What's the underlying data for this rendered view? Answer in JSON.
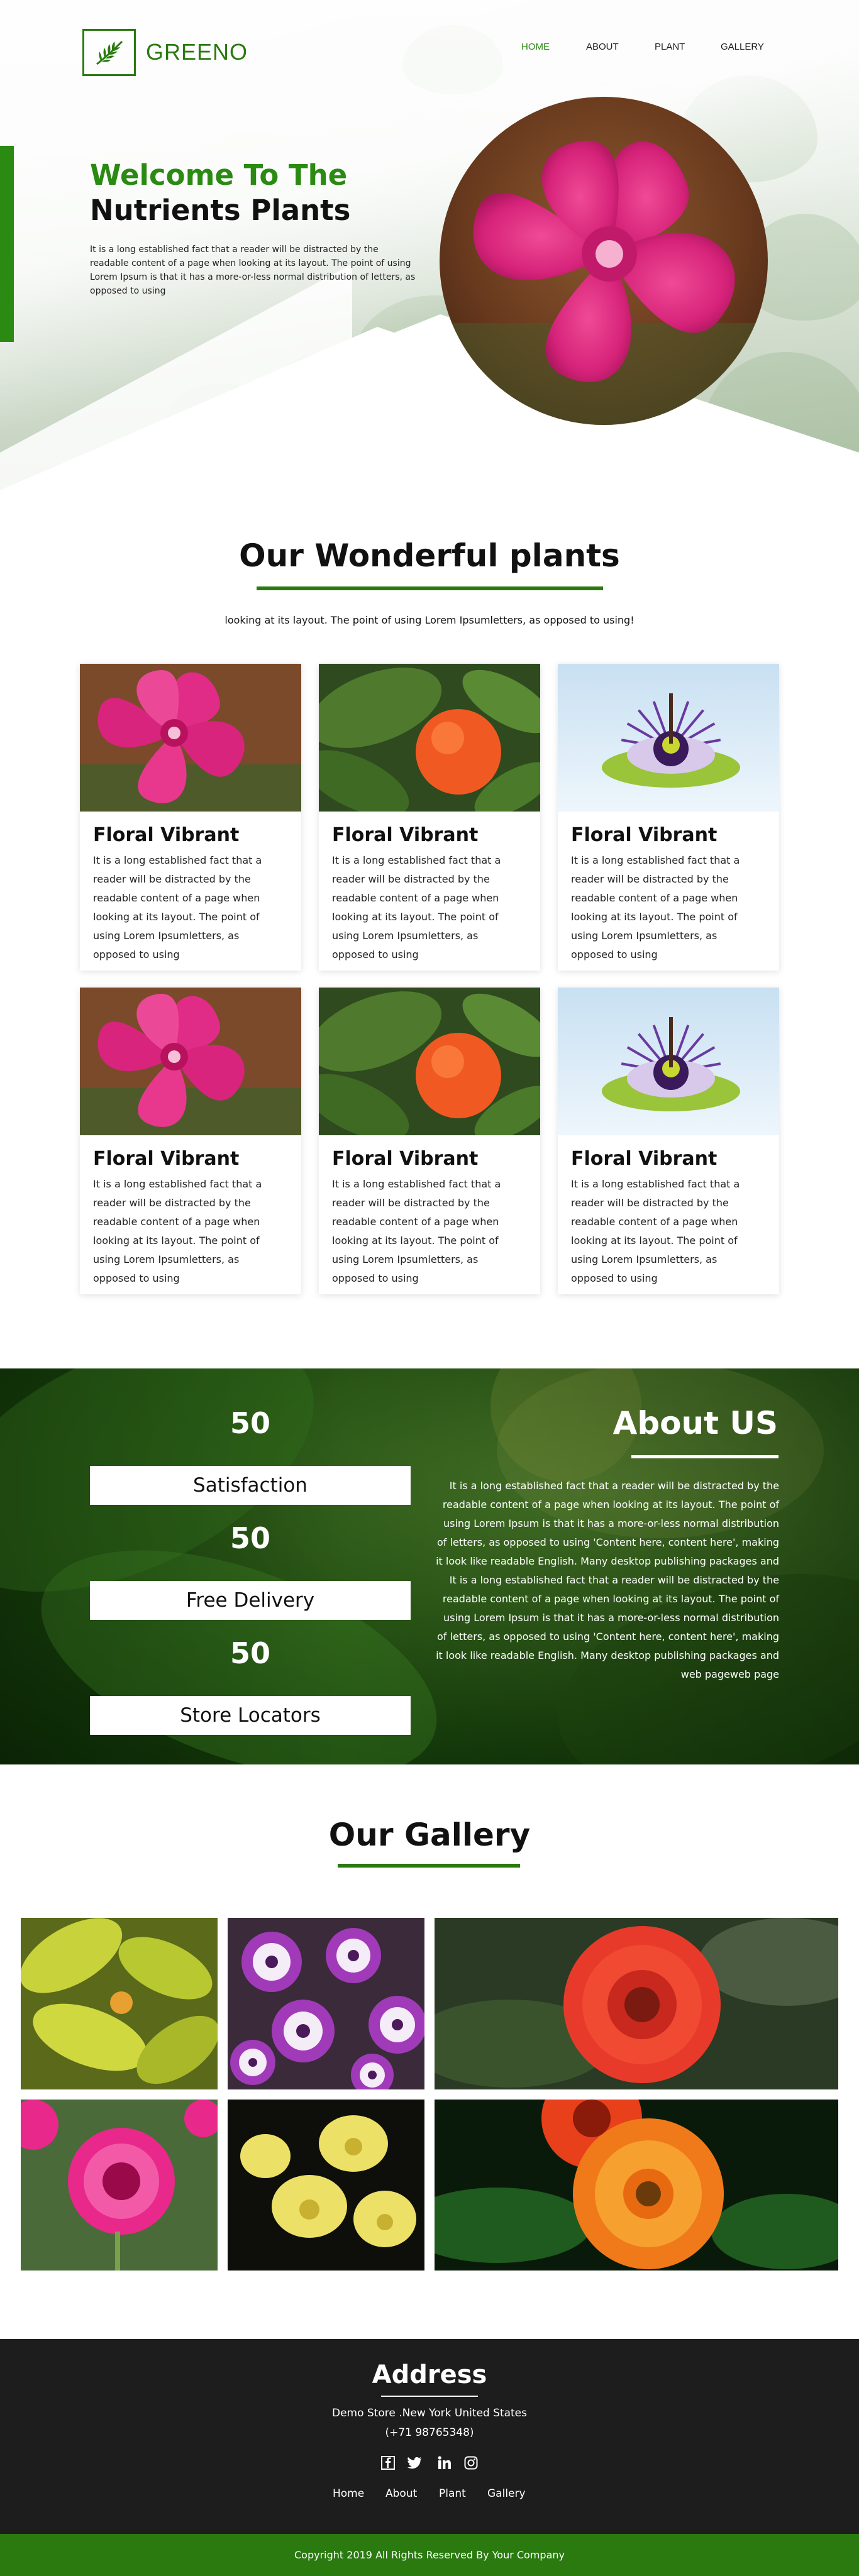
{
  "brand": {
    "name": "GREENO",
    "accent": "#2a7a10"
  },
  "nav": [
    {
      "label": "HOME",
      "active": true
    },
    {
      "label": "ABOUT",
      "active": false
    },
    {
      "label": "PLANT",
      "active": false
    },
    {
      "label": "GALLERY",
      "active": false
    }
  ],
  "hero": {
    "title_line1": "Welcome To The",
    "title_line2": "Nutrients Plants",
    "text": "It is a long established fact that a reader will be distracted by the readable content of a page when looking at its layout. The point of using Lorem Ipsum is that it has a more-or-less normal distribution of letters, as opposed to using"
  },
  "plants": {
    "title": "Our Wonderful plants",
    "subtitle": "looking at its layout. The point of using Lorem Ipsumletters, as opposed to using!",
    "cards": [
      {
        "title": "Floral Vibrant",
        "text": "It is a long established fact that a reader will be distracted by the readable content of a page when looking at its layout. The point of using Lorem Ipsumletters, as opposed to using",
        "image": "pink-flower"
      },
      {
        "title": "Floral Vibrant",
        "text": "It is a long established fact that a reader will be distracted by the readable content of a page when looking at its layout. The point of using Lorem Ipsumletters, as opposed to using",
        "image": "orange-fruit"
      },
      {
        "title": "Floral Vibrant",
        "text": "It is a long established fact that a reader will be distracted by the readable content of a page when looking at its layout. The point of using Lorem Ipsumletters, as opposed to using",
        "image": "passion-flower"
      },
      {
        "title": "Floral Vibrant",
        "text": "It is a long established fact that a reader will be distracted by the readable content of a page when looking at its layout. The point of using Lorem Ipsumletters, as opposed to using",
        "image": "pink-flower"
      },
      {
        "title": "Floral Vibrant",
        "text": "It is a long established fact that a reader will be distracted by the readable content of a page when looking at its layout. The point of using Lorem Ipsumletters, as opposed to using",
        "image": "orange-fruit"
      },
      {
        "title": "Floral Vibrant",
        "text": "It is a long established fact that a reader will be distracted by the readable content of a page when looking at its layout. The point of using Lorem Ipsumletters, as opposed to using",
        "image": "passion-flower"
      }
    ]
  },
  "about": {
    "stats": [
      {
        "number": "50",
        "label": "Satisfaction"
      },
      {
        "number": "50",
        "label": "Free Delivery"
      },
      {
        "number": "50",
        "label": "Store Locators"
      }
    ],
    "title": "About US",
    "text": "It is a long established fact that a reader will be distracted by the readable content of a page when looking at its layout. The point of using Lorem Ipsum is that it has a more-or-less normal distribution of letters, as opposed to using 'Content here, content here', making it look like readable English. Many desktop publishing packages and It is a long established fact that a reader will be distracted by the readable content of a page when looking at its layout. The point of using Lorem Ipsum is that it has a more-or-less normal distribution of letters, as opposed to using 'Content here, content here', making it look like readable English. Many desktop publishing packages and web pageweb page"
  },
  "gallery": {
    "title": "Our Gallery",
    "images": [
      "yellow-leaves",
      "purple-daisies",
      "red-gerbera",
      "pink-dianthus",
      "yellow-orchids",
      "orange-gerbera"
    ]
  },
  "footer": {
    "title": "Address",
    "address": "Demo Store .New York United States",
    "phone": "(+71 98765348)",
    "social": [
      "facebook-icon",
      "twitter-icon",
      "linkedin-icon",
      "instagram-icon"
    ],
    "links": [
      "Home",
      "About",
      "Plant",
      "Gallery"
    ],
    "copyright": "Copyright 2019 All Rights Reserved By Your Company"
  }
}
